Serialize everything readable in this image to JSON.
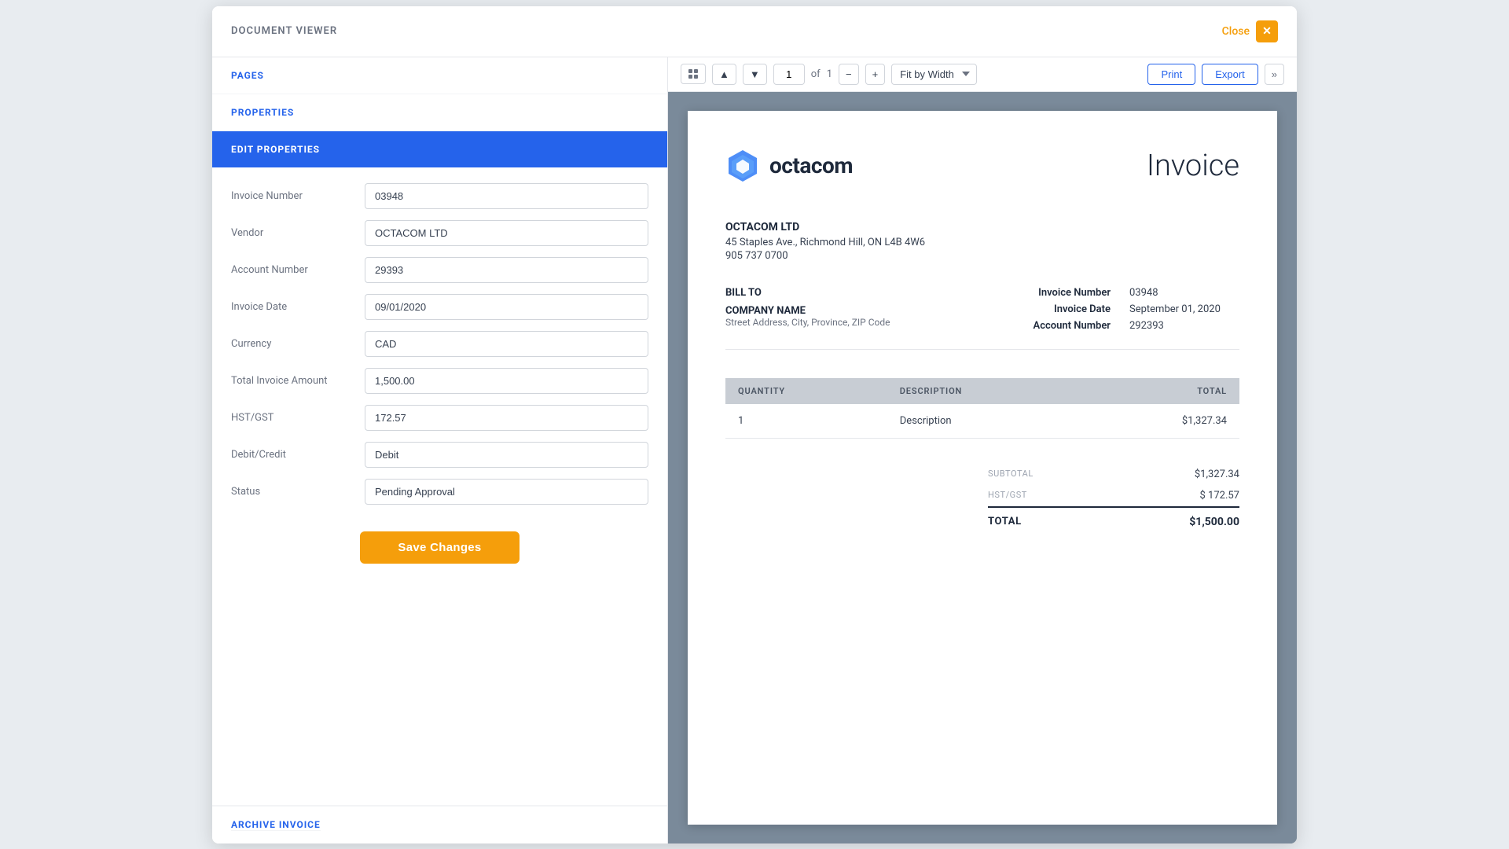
{
  "app": {
    "title": "DOCUMENT VIEWER",
    "close_label": "Close"
  },
  "sidebar": {
    "pages_label": "PAGES",
    "properties_label": "PROPERTIES",
    "edit_properties_label": "EDIT PROPERTIES",
    "archive_label": "ARCHIVE INVOICE"
  },
  "form": {
    "fields": [
      {
        "label": "Invoice Number",
        "value": "03948"
      },
      {
        "label": "Vendor",
        "value": "OCTACOM LTD"
      },
      {
        "label": "Account Number",
        "value": "29393"
      },
      {
        "label": "Invoice Date",
        "value": "09/01/2020"
      },
      {
        "label": "Currency",
        "value": "CAD"
      },
      {
        "label": "Total Invoice Amount",
        "value": "1,500.00"
      },
      {
        "label": "HST/GST",
        "value": "172.57"
      },
      {
        "label": "Debit/Credit",
        "value": "Debit"
      },
      {
        "label": "Status",
        "value": "Pending Approval"
      }
    ],
    "save_button": "Save Changes"
  },
  "toolbar": {
    "page_current": "1",
    "page_total": "1",
    "fit_option": "Fit by Width",
    "print_label": "Print",
    "export_label": "Export"
  },
  "invoice": {
    "company": "octacom",
    "title": "Invoice",
    "from": {
      "name": "OCTACOM LTD",
      "address": "45 Staples Ave., Richmond Hill, ON L4B 4W6",
      "phone": "905 737 0700"
    },
    "bill_to": {
      "label": "BILL TO",
      "company": "COMPANY NAME",
      "address": "Street Address, City, Province, ZIP Code"
    },
    "meta": {
      "invoice_number_label": "Invoice Number",
      "invoice_number_value": "03948",
      "invoice_date_label": "Invoice Date",
      "invoice_date_value": "September 01, 2020",
      "account_number_label": "Account Number",
      "account_number_value": "292393"
    },
    "table": {
      "headers": [
        "QUANTITY",
        "DESCRIPTION",
        "TOTAL"
      ],
      "rows": [
        {
          "quantity": "1",
          "description": "Description",
          "total": "$1,327.34"
        }
      ]
    },
    "totals": {
      "subtotal_label": "SUBTOTAL",
      "subtotal_value": "$1,327.34",
      "hst_label": "HST/GST",
      "hst_value": "$  172.57",
      "total_label": "TOTAL",
      "total_value": "$1,500.00"
    }
  }
}
